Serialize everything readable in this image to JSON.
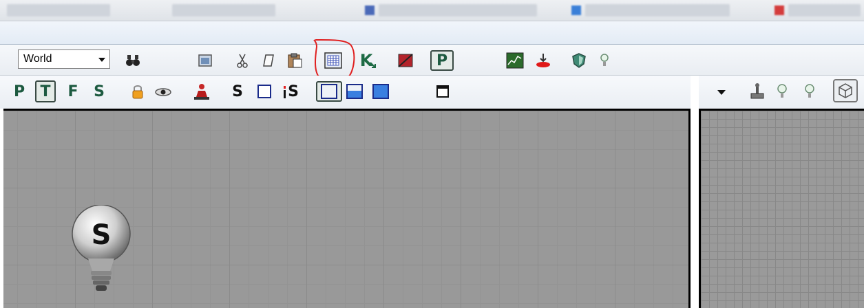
{
  "toolbar1": {
    "world_dropdown": {
      "selected": "World"
    }
  },
  "toolbar2": {
    "mode_p": "P",
    "mode_t": "T",
    "mode_f": "F",
    "mode_s": "S",
    "snap_s": "S",
    "snap_is": "S"
  },
  "toolbar1_icons": {
    "kismet_label": "K",
    "prefab_label": "P"
  },
  "viewport": {
    "static_mesh_letter": "S"
  },
  "colors": {
    "highlight_circle": "#e02020",
    "viewport_grid": "#999999"
  }
}
